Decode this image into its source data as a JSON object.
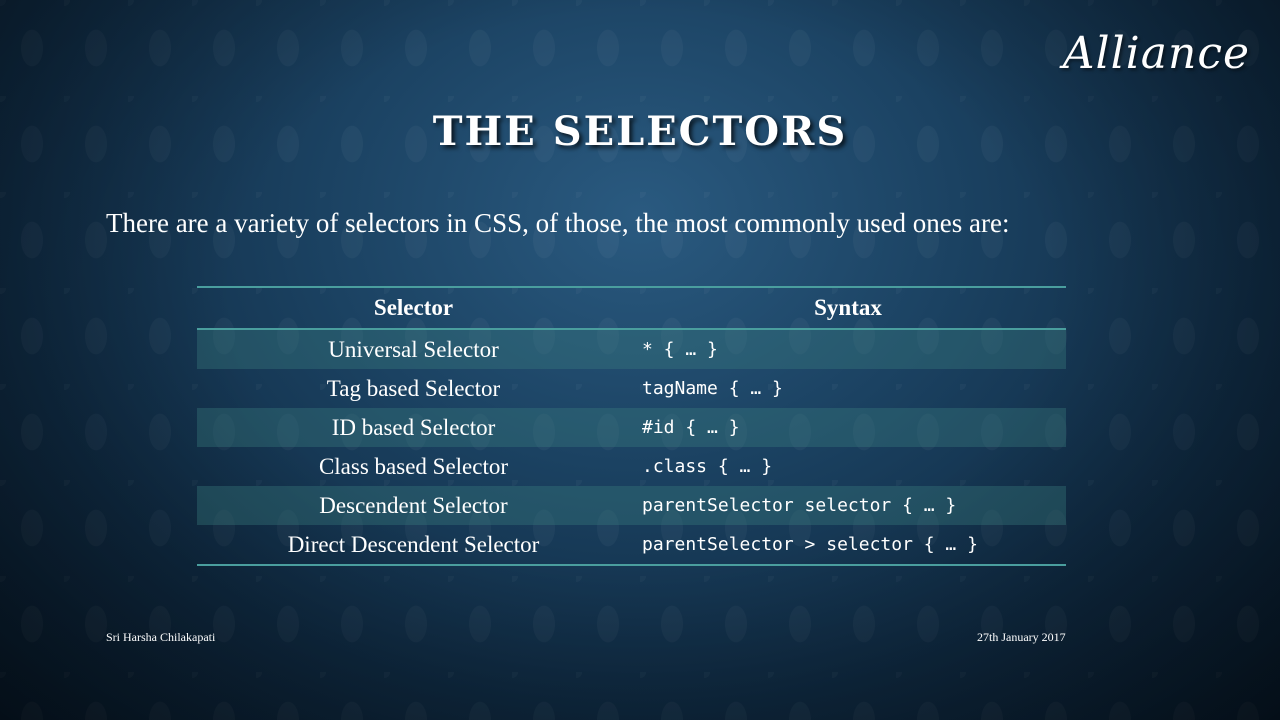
{
  "logo": "Alliance",
  "title": "The Selectors",
  "intro": "There are a variety of selectors in CSS, of those, the most commonly used ones are:",
  "table": {
    "headers": [
      "Selector",
      "Syntax"
    ],
    "rows": [
      {
        "selector": "Universal Selector",
        "syntax": "* { … }"
      },
      {
        "selector": "Tag based Selector",
        "syntax": "tagName { … }"
      },
      {
        "selector": "ID based Selector",
        "syntax": "#id { … }"
      },
      {
        "selector": "Class based Selector",
        "syntax": ".class { … }"
      },
      {
        "selector": "Descendent Selector",
        "syntax": "parentSelector selector { … }"
      },
      {
        "selector": "Direct Descendent Selector",
        "syntax": "parentSelector > selector { … }"
      }
    ]
  },
  "footer": {
    "author": "Sri Harsha Chilakapati",
    "date": "27th January 2017"
  },
  "colors": {
    "table_border": "#4a9e9e",
    "stripe": "#2e6a6e"
  }
}
